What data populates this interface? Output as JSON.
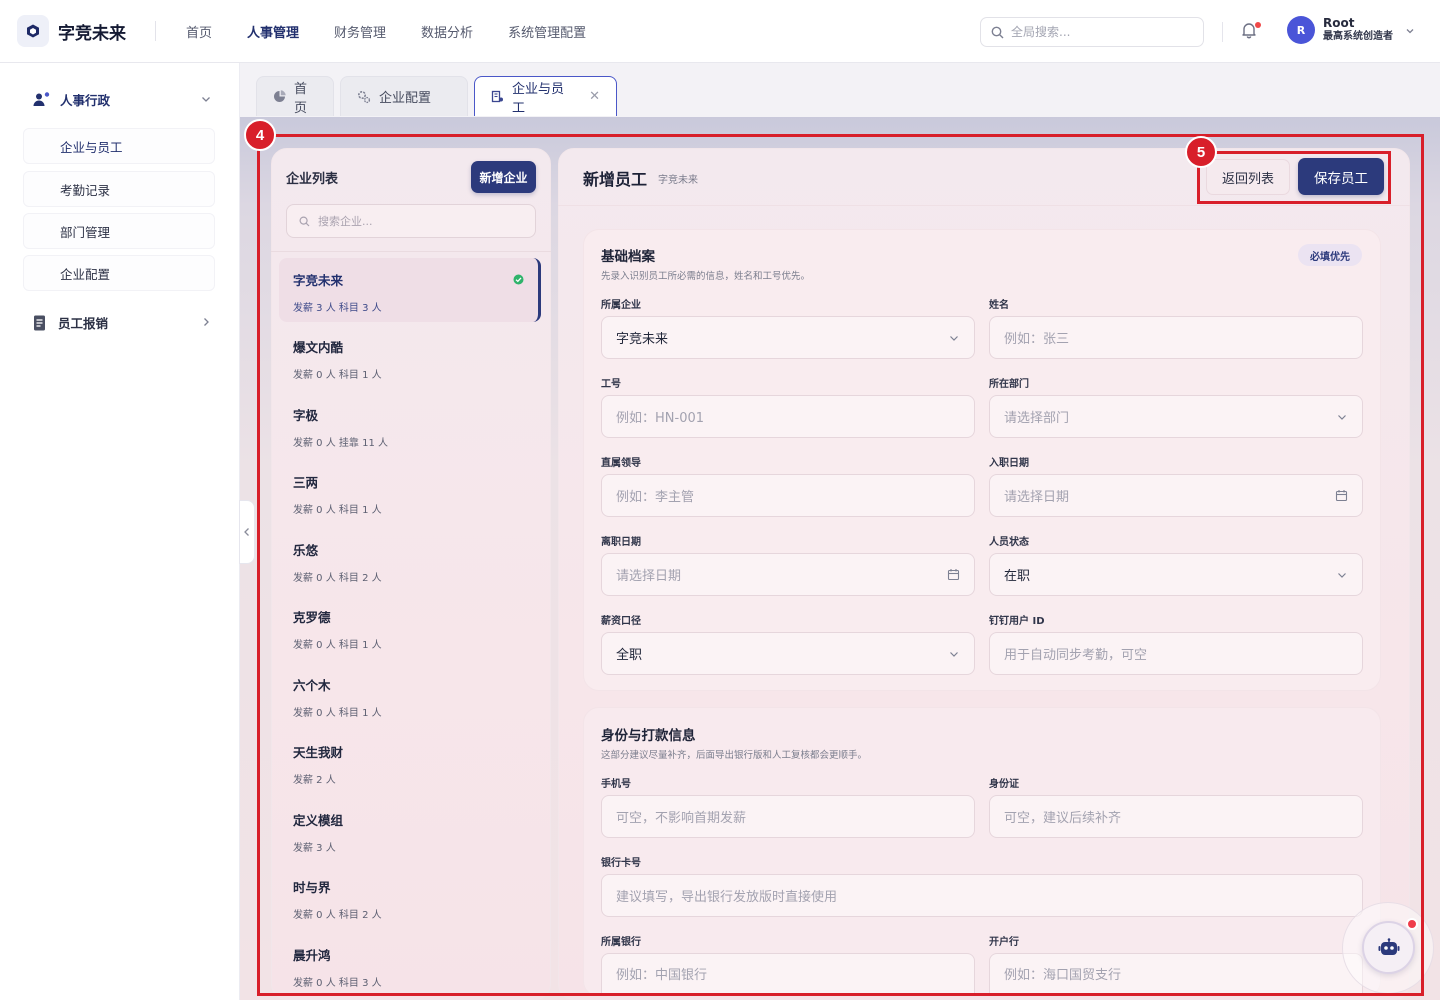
{
  "app": {
    "name": "字竞未来"
  },
  "topnav": [
    "首页",
    "人事管理",
    "财务管理",
    "数据分析",
    "系统管理配置"
  ],
  "search": {
    "placeholder": "全局搜索..."
  },
  "user": {
    "avatar": "R",
    "name": "Root",
    "role": "最高系统创造者"
  },
  "sidebar": {
    "group1": "人事行政",
    "items": [
      "企业与员工",
      "考勤记录",
      "部门管理",
      "企业配置"
    ],
    "group2": "员工报销"
  },
  "tabs": [
    "首页",
    "企业配置",
    "企业与员工"
  ],
  "company_list": {
    "title": "企业列表",
    "add_button": "新增企业",
    "search_placeholder": "搜索企业...",
    "items": [
      {
        "name": "字竞未来",
        "meta": "发薪 3 人  科目 3 人"
      },
      {
        "name": "爆文内酷",
        "meta": "发薪 0 人  科目 1 人"
      },
      {
        "name": "字极",
        "meta": "发薪 0 人  挂靠 11 人"
      },
      {
        "name": "三两",
        "meta": "发薪 0 人  科目 1 人"
      },
      {
        "name": "乐悠",
        "meta": "发薪 0 人  科目 2 人"
      },
      {
        "name": "克罗德",
        "meta": "发薪 0 人  科目 1 人"
      },
      {
        "name": "六个木",
        "meta": "发薪 0 人  科目 1 人"
      },
      {
        "name": "天生我财",
        "meta": "发薪 2 人"
      },
      {
        "name": "定义模组",
        "meta": "发薪 3 人"
      },
      {
        "name": "时与界",
        "meta": "发薪 0 人  科目 2 人"
      },
      {
        "name": "晨升鸿",
        "meta": "发薪 0 人  科目 3 人"
      }
    ]
  },
  "form": {
    "title": "新增员工",
    "subtitle": "字竞未来",
    "back_button": "返回列表",
    "save_button": "保存员工",
    "basic": {
      "title": "基础档案",
      "desc": "先录入识别员工所必需的信息，姓名和工号优先。",
      "badge": "必填优先",
      "company_label": "所属企业",
      "company_value": "字竞未来",
      "name_label": "姓名",
      "name_placeholder": "例如：张三",
      "id_label": "工号",
      "id_placeholder": "例如：HN-001",
      "dept_label": "所在部门",
      "dept_placeholder": "请选择部门",
      "leader_label": "直属领导",
      "leader_placeholder": "例如：李主管",
      "join_label": "入职日期",
      "join_placeholder": "请选择日期",
      "leave_label": "离职日期",
      "leave_placeholder": "请选择日期",
      "status_label": "人员状态",
      "status_value": "在职",
      "salary_label": "薪资口径",
      "salary_value": "全职",
      "ding_label": "钉钉用户 ID",
      "ding_placeholder": "用于自动同步考勤，可空"
    },
    "identity": {
      "title": "身份与打款信息",
      "desc": "这部分建议尽量补齐，后面导出银行版和人工复核都会更顺手。",
      "phone_label": "手机号",
      "phone_placeholder": "可空，不影响首期发薪",
      "idcard_label": "身份证",
      "idcard_placeholder": "可空，建议后续补齐",
      "card_label": "银行卡号",
      "card_placeholder": "建议填写，导出银行发放版时直接使用",
      "bank_label": "所属银行",
      "bank_placeholder": "例如：中国银行",
      "branch_label": "开户行",
      "branch_placeholder": "例如：海口国贸支行"
    }
  },
  "annotations": [
    "4",
    "5"
  ],
  "colors": {
    "primary": "#2c3a7c",
    "annotation": "#d81f2a",
    "success": "#2fb36b"
  }
}
